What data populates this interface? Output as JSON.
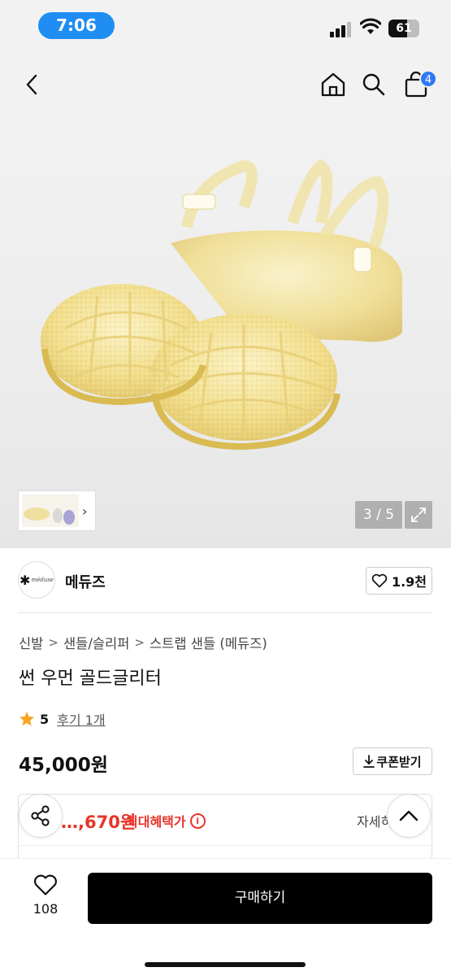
{
  "status": {
    "time": "7:06",
    "battery": "61",
    "battery_level": 0.61
  },
  "nav": {
    "cart_count": "4"
  },
  "gallery": {
    "counter": "3 / 5"
  },
  "brand": {
    "logo_text": "méduse",
    "name": "메듀즈",
    "likes": "1.9천"
  },
  "breadcrumb": [
    "신발",
    "샌들/슬리퍼",
    "스트랩 샌들 (메듀즈)"
  ],
  "product": {
    "title": "썬 우먼 골드글리터",
    "rating": "5",
    "review_link": "후기 1개",
    "price": "45,000원",
    "coupon_label": "쿠폰받기"
  },
  "benefit": {
    "price": "…,670원",
    "label": "최대혜택가",
    "detail": "자세히"
  },
  "bottom": {
    "wish_count": "108",
    "buy_label": "구매하기"
  },
  "colors": {
    "accent": "#2f78f5",
    "time_pill": "#1f8df2",
    "benefit_red": "#e8342a",
    "buy_button": "#000000"
  },
  "icons": [
    "back-icon",
    "home-icon",
    "search-icon",
    "bag-icon",
    "expand-icon",
    "heart-icon",
    "star-icon",
    "download-icon",
    "info-icon",
    "share-icon",
    "chevron-up-icon"
  ]
}
